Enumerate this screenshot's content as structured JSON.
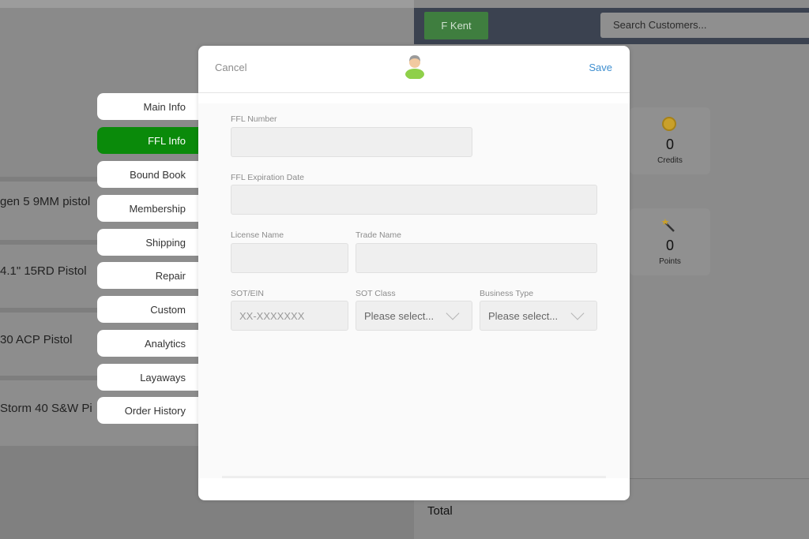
{
  "background": {
    "products": [
      "gen 5 9MM pistol",
      " 4.1\" 15RD Pistol",
      "30 ACP Pistol",
      "Storm 40 S&W Pi"
    ],
    "customer_button": "F Kent",
    "search_placeholder": "Search Customers...",
    "credits": {
      "value": "0",
      "label": "Credits"
    },
    "points": {
      "value": "0",
      "label": "Points"
    },
    "total_label": "Total"
  },
  "tabs": [
    {
      "label": "Main Info",
      "active": false
    },
    {
      "label": "FFL Info",
      "active": true
    },
    {
      "label": "Bound Book",
      "active": false
    },
    {
      "label": "Membership",
      "active": false
    },
    {
      "label": "Shipping",
      "active": false
    },
    {
      "label": "Repair",
      "active": false
    },
    {
      "label": "Custom",
      "active": false
    },
    {
      "label": "Analytics",
      "active": false
    },
    {
      "label": "Layaways",
      "active": false
    },
    {
      "label": "Order History",
      "active": false
    }
  ],
  "modal": {
    "cancel": "Cancel",
    "save": "Save",
    "fields": {
      "ffl_number": {
        "label": "FFL Number",
        "value": ""
      },
      "ffl_expiration": {
        "label": "FFL Expiration Date",
        "value": ""
      },
      "license_name": {
        "label": "License Name",
        "value": ""
      },
      "trade_name": {
        "label": "Trade Name",
        "value": ""
      },
      "sot_ein": {
        "label": "SOT/EIN",
        "placeholder": "XX-XXXXXXX"
      },
      "sot_class": {
        "label": "SOT Class",
        "value": "Please select..."
      },
      "business_type": {
        "label": "Business Type",
        "value": "Please select..."
      }
    }
  },
  "colors": {
    "active_tab": "#0a8a0a",
    "save_link": "#3f8fd0",
    "top_bar": "#3b4250"
  }
}
